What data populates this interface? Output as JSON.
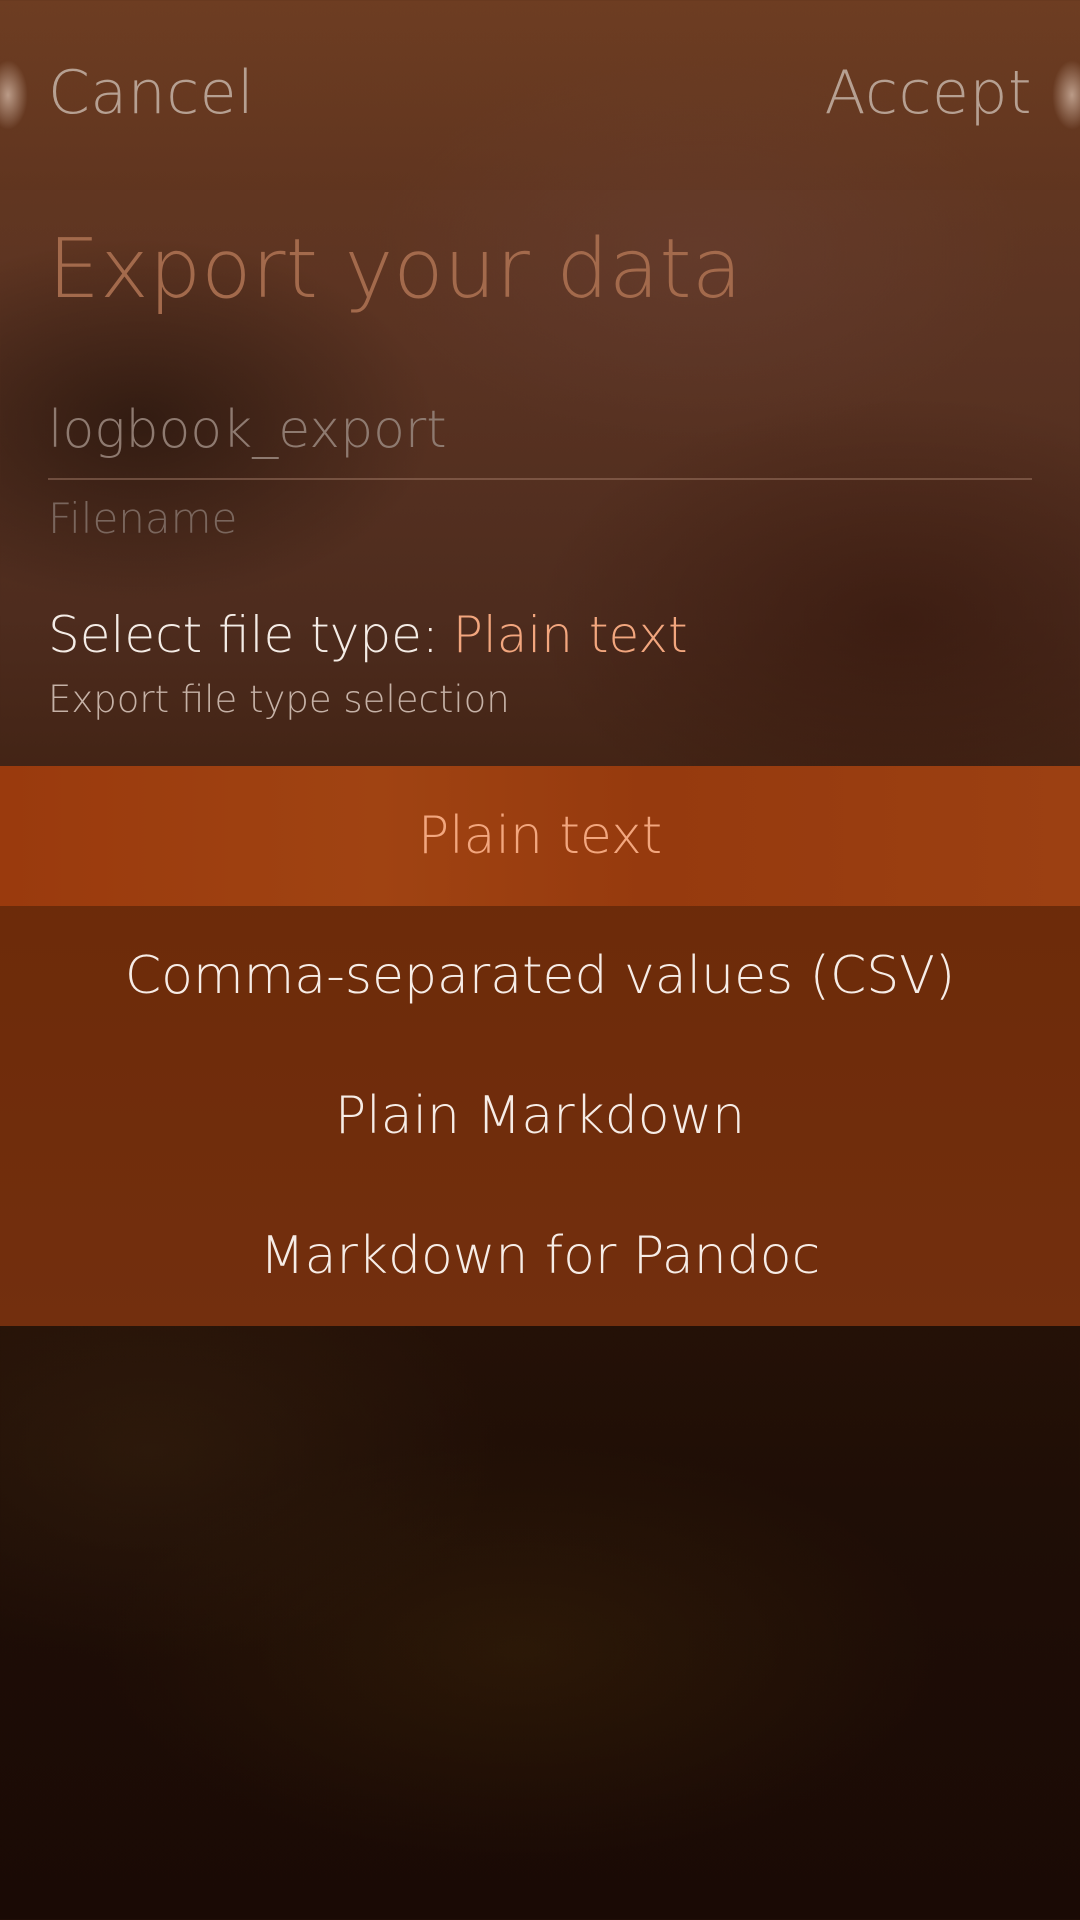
{
  "header": {
    "cancel_label": "Cancel",
    "accept_label": "Accept"
  },
  "page": {
    "title": "Export your data"
  },
  "filename": {
    "value": "logbook_export",
    "label": "Filename"
  },
  "file_type": {
    "label": "Select file type:",
    "selected_value": "Plain text",
    "description": "Export file type selection"
  },
  "menu": {
    "items": [
      {
        "label": "Plain text",
        "selected": true
      },
      {
        "label": "Comma-separated values (CSV)",
        "selected": false
      },
      {
        "label": "Plain Markdown",
        "selected": false
      },
      {
        "label": "Markdown for Pandoc",
        "selected": false
      }
    ]
  },
  "colors": {
    "accent": "#f2a67e",
    "highlight_bg": "#9c4012",
    "menu_bg": "#6f2c0b",
    "title": "#a36a4c"
  }
}
